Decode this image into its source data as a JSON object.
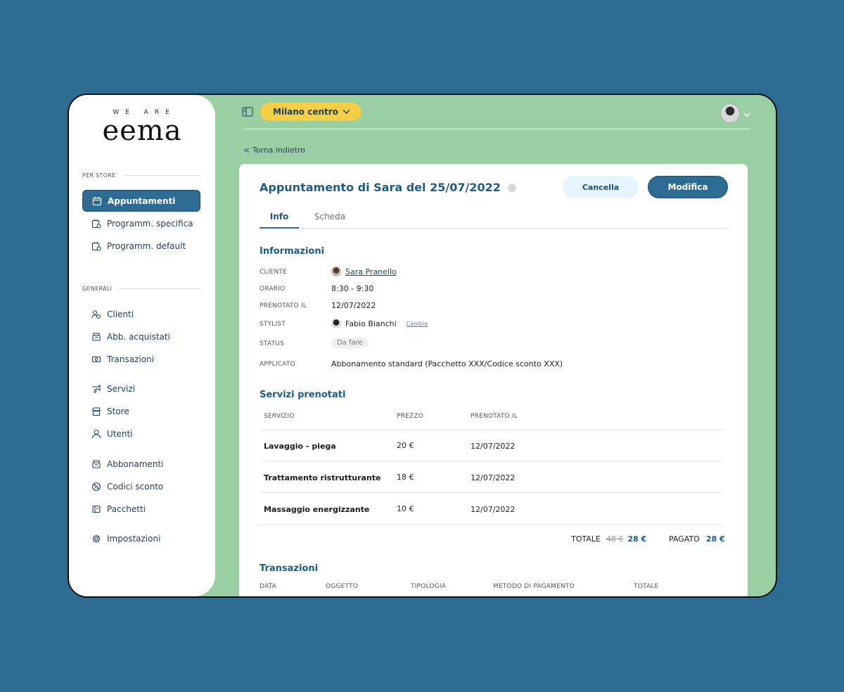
{
  "logo": {
    "top": "WE ARE",
    "main": "eema"
  },
  "sidebar": {
    "section1": "PER STORE",
    "section2": "GENERALI",
    "items": [
      {
        "label": "Appuntamenti",
        "icon": "calendar-icon"
      },
      {
        "label": "Programm. specifica",
        "icon": "calendar-clock-icon"
      },
      {
        "label": "Programm. default",
        "icon": "calendar-clock-icon"
      },
      {
        "label": "Clienti",
        "icon": "clients-icon"
      },
      {
        "label": "Abb. acquistati",
        "icon": "box-icon"
      },
      {
        "label": "Transazioni",
        "icon": "money-icon"
      },
      {
        "label": "Servizi",
        "icon": "hairdryer-icon"
      },
      {
        "label": "Store",
        "icon": "store-icon"
      },
      {
        "label": "Utenti",
        "icon": "user-icon"
      },
      {
        "label": "Abbonamenti",
        "icon": "box-icon"
      },
      {
        "label": "Codici sconto",
        "icon": "discount-icon"
      },
      {
        "label": "Pacchetti",
        "icon": "package-icon"
      },
      {
        "label": "Impostazioni",
        "icon": "gear-icon"
      }
    ]
  },
  "topbar": {
    "store": "Milano centro",
    "back": "< Torna indietro"
  },
  "appointment": {
    "title": "Appuntamento di Sara del 25/07/2022",
    "cancel": "Cancella",
    "edit": "Modifica",
    "tabs": [
      "Info",
      "Scheda"
    ]
  },
  "info": {
    "title": "Informazioni",
    "fields": [
      {
        "label": "CLIENTE",
        "value": "Sara Pranello"
      },
      {
        "label": "ORARIO",
        "value": "8:30 - 9:30"
      },
      {
        "label": "PRENOTATO IL",
        "value": "12/07/2022"
      },
      {
        "label": "STYLIST",
        "value": "Fabio Bianchi"
      },
      {
        "label": "STATUS",
        "value": "Da fare"
      },
      {
        "label": "APPLICATO",
        "value": "Abbonamento standard (Pacchetto XXX/Codice sconto XXX)"
      }
    ],
    "change": "Cambia"
  },
  "services": {
    "title": "Servizi prenotati",
    "headers": [
      "SERVIZIO",
      "PREZZO",
      "PRENOTATO IL"
    ],
    "rows": [
      [
        "Lavaggio - piega",
        "20 €",
        "12/07/2022"
      ],
      [
        "Trattamento ristrutturante",
        "18 €",
        "12/07/2022"
      ],
      [
        "Massaggio energizzante",
        "10 €",
        "12/07/2022"
      ]
    ],
    "total_label": "TOTALE",
    "total_old": "48 €",
    "total": "28 €",
    "paid_label": "PAGATO",
    "paid": "28 €"
  },
  "transactions": {
    "title": "Transazioni",
    "headers": [
      "DATA",
      "OGGETTO",
      "TIPOLOGIA",
      "METODO DI PAGAMENTO",
      "TOTALE"
    ]
  }
}
